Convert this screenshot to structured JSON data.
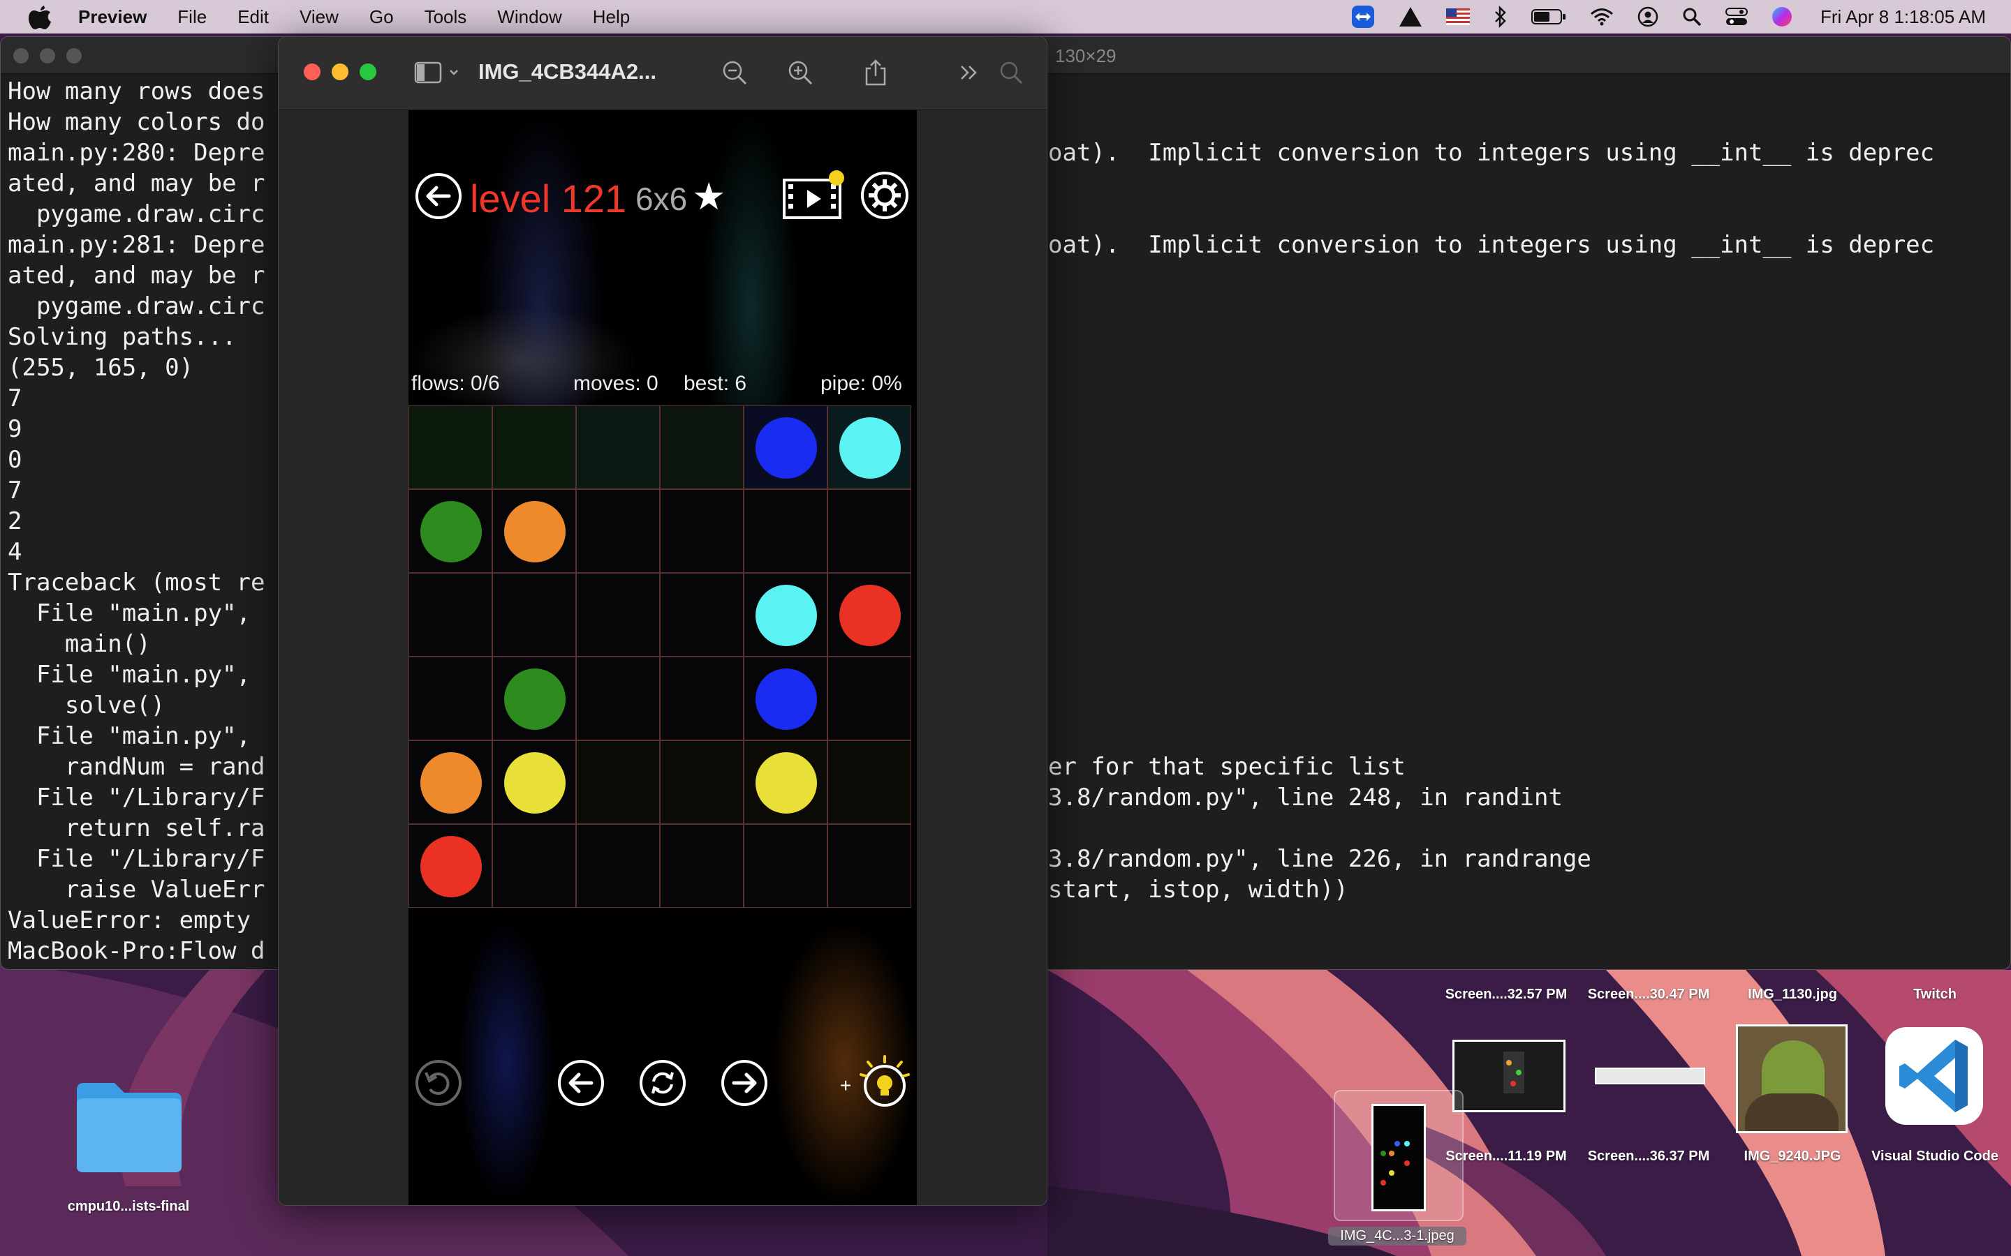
{
  "menubar": {
    "app_name": "Preview",
    "items": [
      "File",
      "Edit",
      "View",
      "Go",
      "Tools",
      "Window",
      "Help"
    ],
    "clock": "Fri Apr 8  1:18:05 AM",
    "status_icons": [
      "teamviewer-icon",
      "drive-icon",
      "us-flag-icon",
      "bluetooth-icon",
      "battery-icon",
      "wifi-icon",
      "user-icon",
      "spotlight-icon",
      "control-center-icon",
      "siri-icon"
    ]
  },
  "terminal": {
    "title": "130×29",
    "left_lines": [
      "How many rows does",
      "How many colors do",
      "main.py:280: Depre",
      "ated, and may be r",
      "  pygame.draw.circ",
      "main.py:281: Depre",
      "ated, and may be r",
      "  pygame.draw.circ",
      "Solving paths...",
      "(255, 165, 0)",
      "7",
      "9",
      "0",
      "7",
      "2",
      "4",
      "Traceback (most re",
      "  File \"main.py\",",
      "    main()",
      "  File \"main.py\",",
      "    solve()",
      "  File \"main.py\",",
      "    randNum = rand",
      "  File \"/Library/F",
      "    return self.ra",
      "  File \"/Library/F",
      "    raise ValueErr",
      "ValueError: empty",
      "MacBook-Pro:Flow d"
    ],
    "right_lines": [
      "",
      "",
      "oat).  Implicit conversion to integers using __int__ is deprec",
      "",
      "",
      "oat).  Implicit conversion to integers using __int__ is deprec",
      "",
      "",
      "",
      "",
      "",
      "",
      "",
      "",
      "",
      "",
      "",
      "",
      "",
      "",
      "",
      "",
      "er for that specific list",
      "3.8/random.py\", line 248, in randint",
      "",
      "3.8/random.py\", line 226, in randrange",
      "start, istop, width))",
      "",
      ""
    ]
  },
  "preview": {
    "title": "IMG_4CB344A2...",
    "toolbar_icons": [
      "sidebar-toggle-icon",
      "zoom-out-icon",
      "zoom-in-icon",
      "share-icon",
      "more-tools-icon",
      "search-icon"
    ]
  },
  "game": {
    "level": "level 121",
    "size": "6x6",
    "star": "★",
    "flows": "flows: 0/6",
    "moves": "moves: 0",
    "best": "best: 6",
    "pipe": "pipe: 0%",
    "colors": {
      "blue": "#1a2cf2",
      "cyan": "#5af2f2",
      "green": "#2e8c1e",
      "orange": "#ef8a2c",
      "red": "#ea3224",
      "yellow": "#e8df38"
    },
    "grid": [
      [
        "",
        "",
        "",
        "",
        "blue",
        "cyan"
      ],
      [
        "green",
        "orange",
        "",
        "",
        "",
        ""
      ],
      [
        "",
        "",
        "",
        "",
        "cyan",
        "red"
      ],
      [
        "",
        "green",
        "",
        "",
        "blue",
        ""
      ],
      [
        "orange",
        "yellow",
        "",
        "",
        "yellow",
        ""
      ],
      [
        "red",
        "",
        "",
        "",
        "",
        ""
      ]
    ],
    "hint_prefix": "+"
  },
  "desktop": {
    "folder_label": "cmpu10...ists-final",
    "items": [
      {
        "label": "Screen....32.57 PM"
      },
      {
        "label": "Screen....30.47 PM"
      },
      {
        "label": "IMG_1130.jpg"
      },
      {
        "label": "Twitch"
      },
      {
        "label": "Screen....11.19 PM"
      },
      {
        "label": "Screen....36.37 PM"
      },
      {
        "label": "IMG_9240.JPG"
      },
      {
        "label": "Visual Studio Code"
      },
      {
        "label": "IMG_4C...3-1.jpeg"
      }
    ]
  }
}
